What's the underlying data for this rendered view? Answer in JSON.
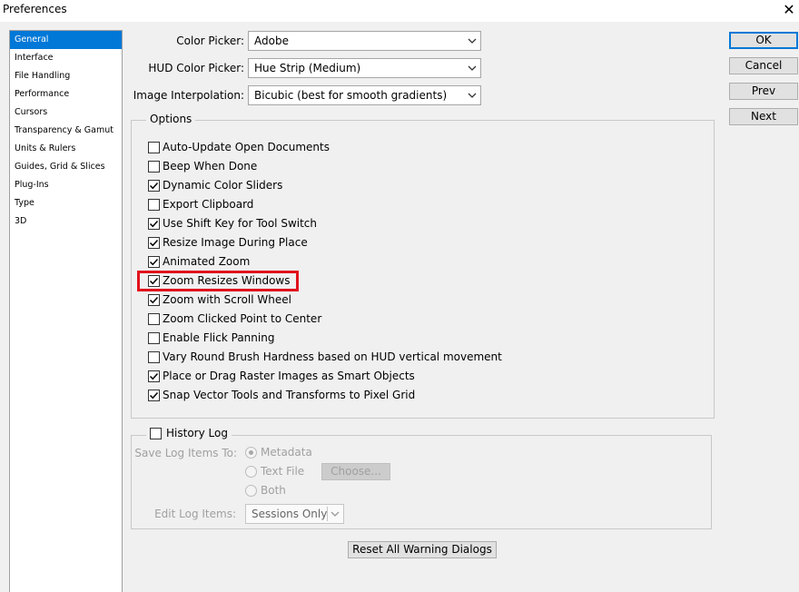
{
  "window": {
    "title": "Preferences",
    "close_glyph": "✕"
  },
  "nav": {
    "items": [
      "General",
      "Interface",
      "File Handling",
      "Performance",
      "Cursors",
      "Transparency & Gamut",
      "Units & Rulers",
      "Guides, Grid & Slices",
      "Plug-Ins",
      "Type",
      "3D"
    ],
    "selected": "General"
  },
  "fields": {
    "color_picker": {
      "label": "Color Picker:",
      "value": "Adobe"
    },
    "hud_color_picker": {
      "label": "HUD Color Picker:",
      "value": "Hue Strip (Medium)"
    },
    "image_interpolation": {
      "label": "Image Interpolation:",
      "value": "Bicubic (best for smooth gradients)"
    }
  },
  "options": {
    "legend": "Options",
    "items": [
      {
        "label": "Auto-Update Open Documents",
        "checked": false
      },
      {
        "label": "Beep When Done",
        "checked": false
      },
      {
        "label": "Dynamic Color Sliders",
        "checked": true
      },
      {
        "label": "Export Clipboard",
        "checked": false
      },
      {
        "label": "Use Shift Key for Tool Switch",
        "checked": true
      },
      {
        "label": "Resize Image During Place",
        "checked": true
      },
      {
        "label": "Animated Zoom",
        "checked": true
      },
      {
        "label": "Zoom Resizes Windows",
        "checked": true
      },
      {
        "label": "Zoom with Scroll Wheel",
        "checked": true
      },
      {
        "label": "Zoom Clicked Point to Center",
        "checked": false
      },
      {
        "label": "Enable Flick Panning",
        "checked": false
      },
      {
        "label": "Vary Round Brush Hardness based on HUD vertical movement",
        "checked": false
      },
      {
        "label": "Place or Drag Raster Images as Smart Objects",
        "checked": true
      },
      {
        "label": "Snap Vector Tools and Transforms to Pixel Grid",
        "checked": true
      }
    ],
    "highlighted_item": "Zoom Resizes Windows"
  },
  "history_log": {
    "label": "History Log",
    "checked": false,
    "save_to_label": "Save Log Items To:",
    "save_options": [
      "Metadata",
      "Text File",
      "Both"
    ],
    "save_selected": "Metadata",
    "choose_button": "Choose...",
    "edit_label": "Edit Log Items:",
    "edit_value": "Sessions Only"
  },
  "buttons": {
    "ok": "OK",
    "cancel": "Cancel",
    "prev": "Prev",
    "next": "Next",
    "reset_warnings": "Reset All Warning Dialogs"
  },
  "colors": {
    "accent": "#0078d7",
    "highlight_box": "#e0121c",
    "disabled_text": "#a0a0a0"
  }
}
